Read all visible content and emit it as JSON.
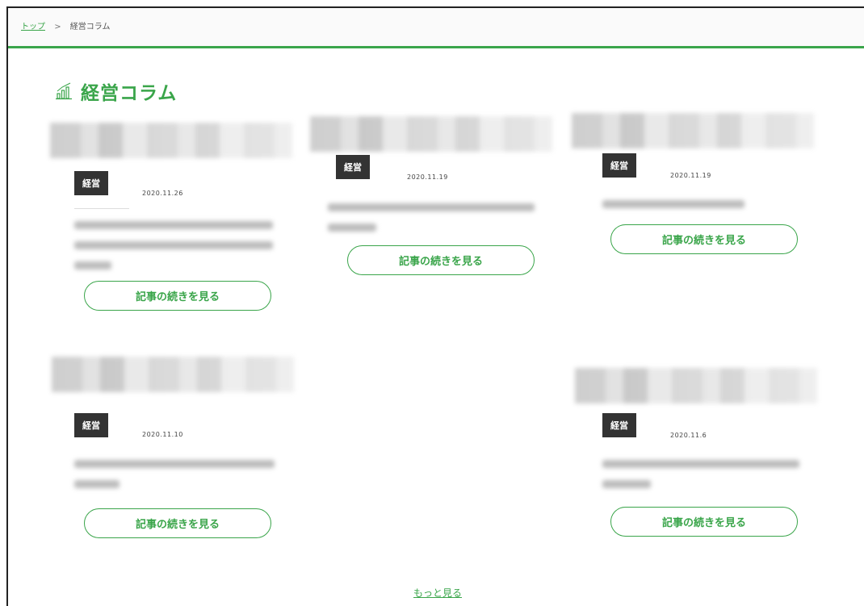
{
  "breadcrumb": {
    "home": "トップ",
    "separator": ">",
    "current": "経営コラム"
  },
  "page_title": "経営コラム",
  "colors": {
    "accent": "#3aa54a",
    "tag_bg": "#333333"
  },
  "cards": [
    {
      "tag": "経営",
      "date": "2020.11.26",
      "button": "記事の続きを見る"
    },
    {
      "tag": "経営",
      "date": "2020.11.19",
      "button": "記事の続きを見る"
    },
    {
      "tag": "経営",
      "date": "2020.11.19",
      "button": "記事の続きを見る"
    },
    {
      "tag": "経営",
      "date": "2020.11.10",
      "button": "記事の続きを見る"
    },
    {
      "tag": "経営",
      "date": "2020.11.6",
      "button": "記事の続きを見る"
    }
  ],
  "more_link": "もっと見る"
}
